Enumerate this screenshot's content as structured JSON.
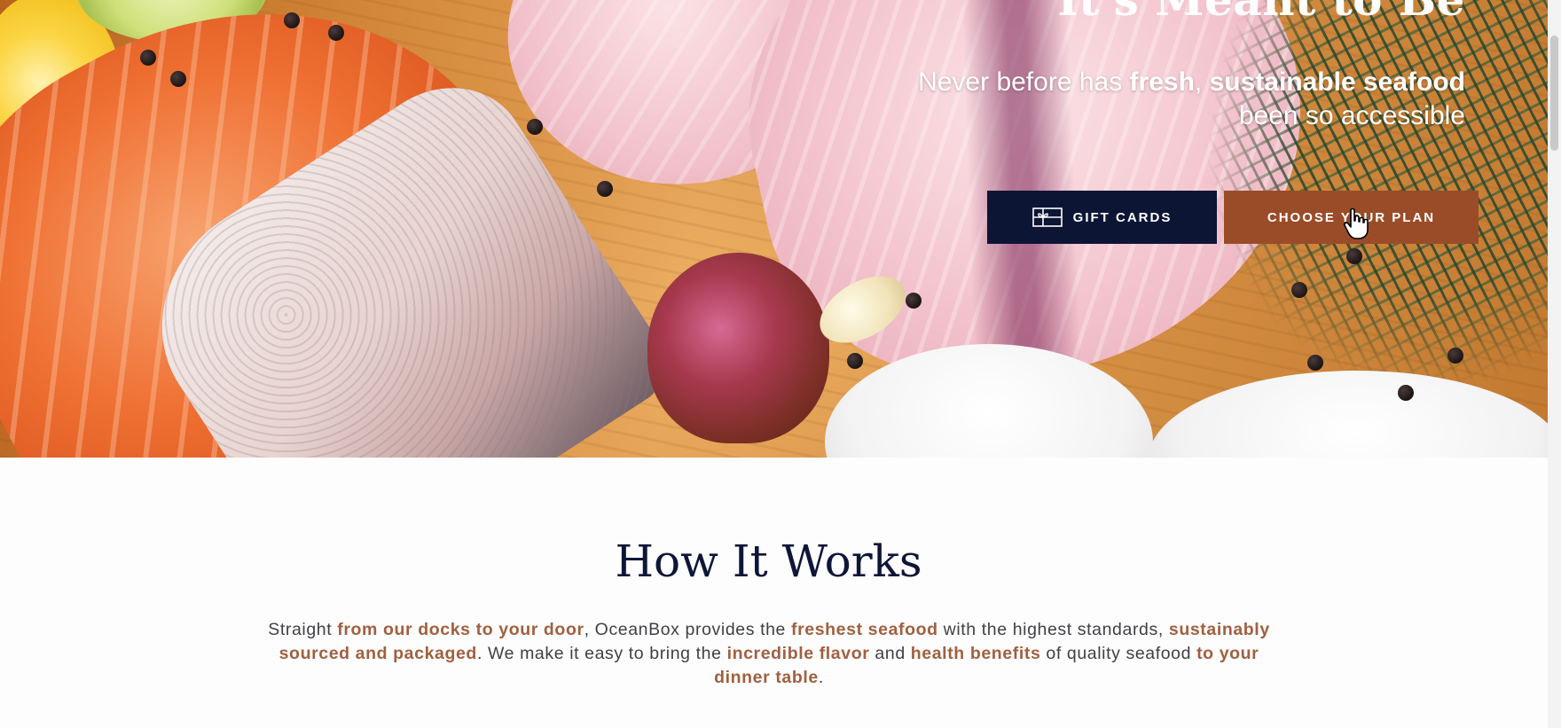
{
  "hero": {
    "title": "It's Meant to Be",
    "subtitle": {
      "part1": "Never before has ",
      "bold1": "fresh",
      "part2": ", ",
      "bold2": "sustainable seafood",
      "part3": " been so accessible"
    },
    "gift_cards_label": "GIFT CARDS",
    "choose_plan_label": "CHOOSE YOUR PLAN",
    "gift_icon": "gift-card-icon",
    "cursor_icon": "hand-pointer-icon"
  },
  "how_it_works": {
    "title": "How It Works",
    "body": {
      "t1": "Straight ",
      "h1": "from our docks to your door",
      "t2": ", OceanBox provides the ",
      "h2": "freshest seafood",
      "t3": " with the highest standards, ",
      "h3": "sustainably sourced and packaged",
      "t4": ". We make it easy to bring the ",
      "h4": "incredible flavor",
      "t5": " and ",
      "h5": "health benefits",
      "t6": " of quality seafood ",
      "h6": "to your dinner table",
      "t7": "."
    }
  },
  "colors": {
    "navy": "#0d1535",
    "rust": "#9a4c28",
    "highlight": "#a1603f",
    "heading": "#0e1638"
  }
}
